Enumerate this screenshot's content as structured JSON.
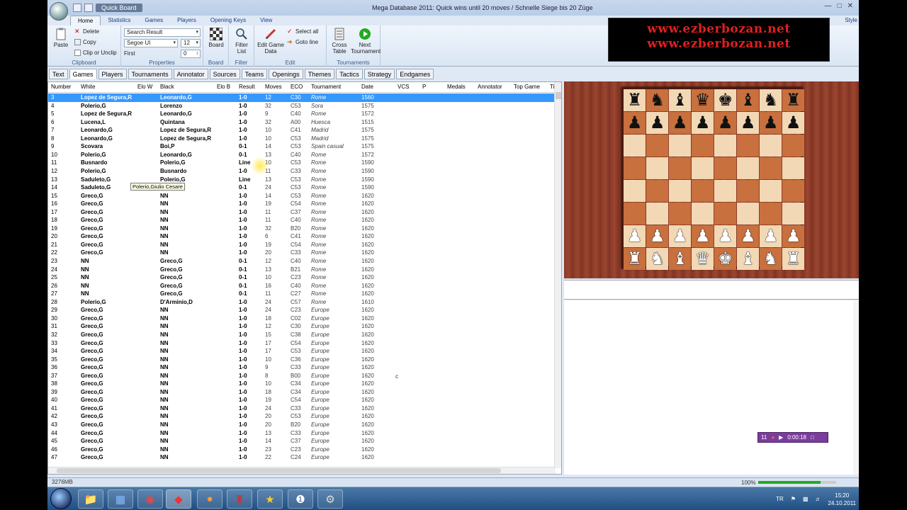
{
  "window": {
    "quickboard_label": "Quick Board",
    "title": "Mega Database 2011:  Quick wins until 20 moves        / Schnelle Siege bis 20 Züge",
    "style_label": "Style"
  },
  "ribbon_tabs": [
    "Home",
    "Statistics",
    "Games",
    "Players",
    "Opening Keys",
    "View"
  ],
  "ribbon": {
    "clipboard": {
      "paste": "Paste",
      "delete": "Delete",
      "copy": "Copy",
      "clip": "Clip or Unclip",
      "label": "Clipboard"
    },
    "properties": {
      "search": "Search Result",
      "font": "Segoe UI",
      "size": "12",
      "first_label": "First",
      "first_value": "0",
      "label": "Properties"
    },
    "board": {
      "board": "Board",
      "label": "Board"
    },
    "filter": {
      "filter_list": "Filter List",
      "label": "Filter"
    },
    "edit": {
      "edit_game_data": "Edit Game Data",
      "select_all": "Select all",
      "goto_line": "Goto line",
      "label": "Edit"
    },
    "tournaments": {
      "cross_table": "Cross Table",
      "next_tournament": "Next Tournament",
      "label": "Tournaments"
    }
  },
  "subtabs": [
    "Text",
    "Games",
    "Players",
    "Tournaments",
    "Annotator",
    "Sources",
    "Teams",
    "Openings",
    "Themes",
    "Tactics",
    "Strategy",
    "Endgames"
  ],
  "columns": [
    "Number",
    "White",
    "Elo W",
    "Black",
    "Elo B",
    "Result",
    "Moves",
    "ECO",
    "Tournament",
    "Date",
    "VCS",
    "P",
    "Medals",
    "Annotator",
    "Top Game",
    "Ti"
  ],
  "rows": [
    [
      "3",
      "Lopez de Segura,R",
      "Leonardo,G",
      "1-0",
      "12",
      "C30",
      "Rome",
      "1560"
    ],
    [
      "4",
      "Polerio,G",
      "Lorenzo",
      "1-0",
      "32",
      "C53",
      "Sora",
      "1575"
    ],
    [
      "5",
      "Lopez de Segura,R",
      "Leonardo,G",
      "1-0",
      "9",
      "C40",
      "Rome",
      "1572"
    ],
    [
      "6",
      "Lucena,L",
      "Quintana",
      "1-0",
      "32",
      "A00",
      "Huesca",
      "1515"
    ],
    [
      "7",
      "Leonardo,G",
      "Lopez de Segura,R",
      "1-0",
      "10",
      "C41",
      "Madrid",
      "1575"
    ],
    [
      "8",
      "Leonardo,G",
      "Lopez de Segura,R",
      "1-0",
      "10",
      "C53",
      "Madrid",
      "1575"
    ],
    [
      "9",
      "Scovara",
      "Boi,P",
      "0-1",
      "14",
      "C53",
      "Spain casual",
      "1575"
    ],
    [
      "10",
      "Polerio,G",
      "Leonardo,G",
      "0-1",
      "13",
      "C40",
      "Rome",
      "1572"
    ],
    [
      "11",
      "Busnardo",
      "Polerio,G",
      "Line",
      "10",
      "C53",
      "Rome",
      "1590"
    ],
    [
      "12",
      "Polerio,G",
      "Busnardo",
      "1-0",
      "11",
      "C33",
      "Rome",
      "1590"
    ],
    [
      "13",
      "Saduleto,G",
      "Polerio,G",
      "Line",
      "13",
      "C53",
      "Rome",
      "1590"
    ],
    [
      "14",
      "Saduleto,G",
      "Polerio,G",
      "0-1",
      "24",
      "C53",
      "Rome",
      "1590"
    ],
    [
      "15",
      "Greco,G",
      "NN",
      "1-0",
      "14",
      "C53",
      "Rome",
      "1620"
    ],
    [
      "16",
      "Greco,G",
      "NN",
      "1-0",
      "19",
      "C54",
      "Rome",
      "1620"
    ],
    [
      "17",
      "Greco,G",
      "NN",
      "1-0",
      "11",
      "C37",
      "Rome",
      "1620"
    ],
    [
      "18",
      "Greco,G",
      "NN",
      "1-0",
      "11",
      "C40",
      "Rome",
      "1620"
    ],
    [
      "19",
      "Greco,G",
      "NN",
      "1-0",
      "32",
      "B20",
      "Rome",
      "1620"
    ],
    [
      "20",
      "Greco,G",
      "NN",
      "1-0",
      "6",
      "C41",
      "Rome",
      "1620"
    ],
    [
      "21",
      "Greco,G",
      "NN",
      "1-0",
      "19",
      "C54",
      "Rome",
      "1620"
    ],
    [
      "22",
      "Greco,G",
      "NN",
      "1-0",
      "20",
      "C33",
      "Rome",
      "1620"
    ],
    [
      "23",
      "NN",
      "Greco,G",
      "0-1",
      "12",
      "C40",
      "Rome",
      "1620"
    ],
    [
      "24",
      "NN",
      "Greco,G",
      "0-1",
      "13",
      "B21",
      "Rome",
      "1620"
    ],
    [
      "25",
      "NN",
      "Greco,G",
      "0-1",
      "10",
      "C23",
      "Rome",
      "1620"
    ],
    [
      "26",
      "NN",
      "Greco,G",
      "0-1",
      "16",
      "C40",
      "Rome",
      "1620"
    ],
    [
      "27",
      "NN",
      "Greco,G",
      "0-1",
      "11",
      "C27",
      "Rome",
      "1620"
    ],
    [
      "28",
      "Polerio,G",
      "D'Arminio,D",
      "1-0",
      "24",
      "C57",
      "Rome",
      "1610"
    ],
    [
      "29",
      "Greco,G",
      "NN",
      "1-0",
      "24",
      "C23",
      "Europe",
      "1620"
    ],
    [
      "30",
      "Greco,G",
      "NN",
      "1-0",
      "18",
      "C02",
      "Europe",
      "1620"
    ],
    [
      "31",
      "Greco,G",
      "NN",
      "1-0",
      "12",
      "C30",
      "Europe",
      "1620"
    ],
    [
      "32",
      "Greco,G",
      "NN",
      "1-0",
      "15",
      "C38",
      "Europe",
      "1620"
    ],
    [
      "33",
      "Greco,G",
      "NN",
      "1-0",
      "17",
      "C54",
      "Europe",
      "1620"
    ],
    [
      "34",
      "Greco,G",
      "NN",
      "1-0",
      "17",
      "C53",
      "Europe",
      "1620"
    ],
    [
      "35",
      "Greco,G",
      "NN",
      "1-0",
      "10",
      "C36",
      "Europe",
      "1620"
    ],
    [
      "36",
      "Greco,G",
      "NN",
      "1-0",
      "9",
      "C33",
      "Europe",
      "1620"
    ],
    [
      "37",
      "Greco,G",
      "NN",
      "1-0",
      "8",
      "B00",
      "Europe",
      "1620"
    ],
    [
      "38",
      "Greco,G",
      "NN",
      "1-0",
      "10",
      "C34",
      "Europe",
      "1620"
    ],
    [
      "39",
      "Greco,G",
      "NN",
      "1-0",
      "18",
      "C34",
      "Europe",
      "1620"
    ],
    [
      "40",
      "Greco,G",
      "NN",
      "1-0",
      "19",
      "C54",
      "Europe",
      "1620"
    ],
    [
      "41",
      "Greco,G",
      "NN",
      "1-0",
      "24",
      "C33",
      "Europe",
      "1620"
    ],
    [
      "42",
      "Greco,G",
      "NN",
      "1-0",
      "20",
      "C53",
      "Europe",
      "1620"
    ],
    [
      "43",
      "Greco,G",
      "NN",
      "1-0",
      "20",
      "B20",
      "Europe",
      "1620"
    ],
    [
      "44",
      "Greco,G",
      "NN",
      "1-0",
      "13",
      "C33",
      "Europe",
      "1620"
    ],
    [
      "45",
      "Greco,G",
      "NN",
      "1-0",
      "14",
      "C37",
      "Europe",
      "1620"
    ],
    [
      "46",
      "Greco,G",
      "NN",
      "1-0",
      "23",
      "C23",
      "Europe",
      "1620"
    ],
    [
      "47",
      "Greco,G",
      "NN",
      "1-0",
      "22",
      "C24",
      "Europe",
      "1620"
    ]
  ],
  "selected_row": 0,
  "tooltip": "Polerio,Giulio Cesare",
  "stray_char": "c",
  "watermark": [
    "www.ezberbozan.net",
    "www.ezberbozan.net"
  ],
  "board": {
    "rows": [
      [
        "r",
        "n",
        "b",
        "q",
        "k",
        "b",
        "n",
        "r"
      ],
      [
        "p",
        "p",
        "p",
        "p",
        "p",
        "p",
        "p",
        "p"
      ],
      [
        "",
        "",
        "",
        "",
        "",
        "",
        "",
        ""
      ],
      [
        "",
        "",
        "",
        "",
        "",
        "",
        "",
        ""
      ],
      [
        "",
        "",
        "",
        "",
        "",
        "",
        "",
        ""
      ],
      [
        "",
        "",
        "",
        "",
        "",
        "",
        "",
        ""
      ],
      [
        "P",
        "P",
        "P",
        "P",
        "P",
        "P",
        "P",
        "P"
      ],
      [
        "R",
        "N",
        "B",
        "Q",
        "K",
        "B",
        "N",
        "R"
      ]
    ]
  },
  "video": {
    "time": "0:00:18",
    "count": "11"
  },
  "status": {
    "memory": "3276MB",
    "zoom": "100%",
    "zoom_fraction": 0.8
  },
  "tray": {
    "lang": "TR",
    "time": "15:20",
    "date": "24.10.2011"
  },
  "colors": {
    "selection": "#3399ff",
    "board_light": "#f2d8b4",
    "board_dark": "#c8703e",
    "watermark": "#e02020"
  }
}
